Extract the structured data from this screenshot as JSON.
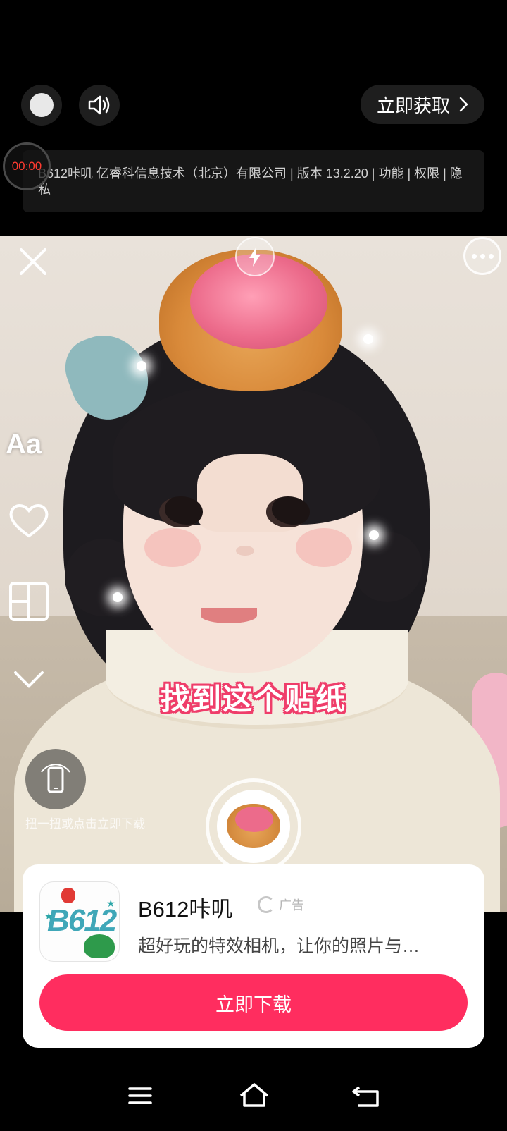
{
  "ad_header": {
    "skip_icon": "skip-dot-icon",
    "sound_icon": "speaker-icon",
    "get_button_label": "立即获取",
    "timer": "00:00",
    "app_info": "B612咔叽 亿睿科信息技术（北京）有限公司 | 版本 13.2.20 | 功能 | 权限 | 隐私"
  },
  "video": {
    "caption": "找到这个贴纸",
    "tools": {
      "text_label": "Aa",
      "close_icon": "close-icon",
      "flash_icon": "flash-icon",
      "more_icon": "more-icon",
      "heart_icon": "heart-icon",
      "layout_icon": "layout-icon",
      "chevron_icon": "chevron-down-icon"
    },
    "rotate_hint": "扭一扭或点击立即下载"
  },
  "ad_card": {
    "app_name": "B612咔叽",
    "ad_label": "广告",
    "description": "超好玩的特效相机，让你的照片与…",
    "download_label": "立即下载",
    "icon_text": "B612",
    "accent_color": "#ff2d5f"
  },
  "nav": {
    "menu_icon": "menu-icon",
    "home_icon": "home-icon",
    "back_icon": "back-icon"
  }
}
